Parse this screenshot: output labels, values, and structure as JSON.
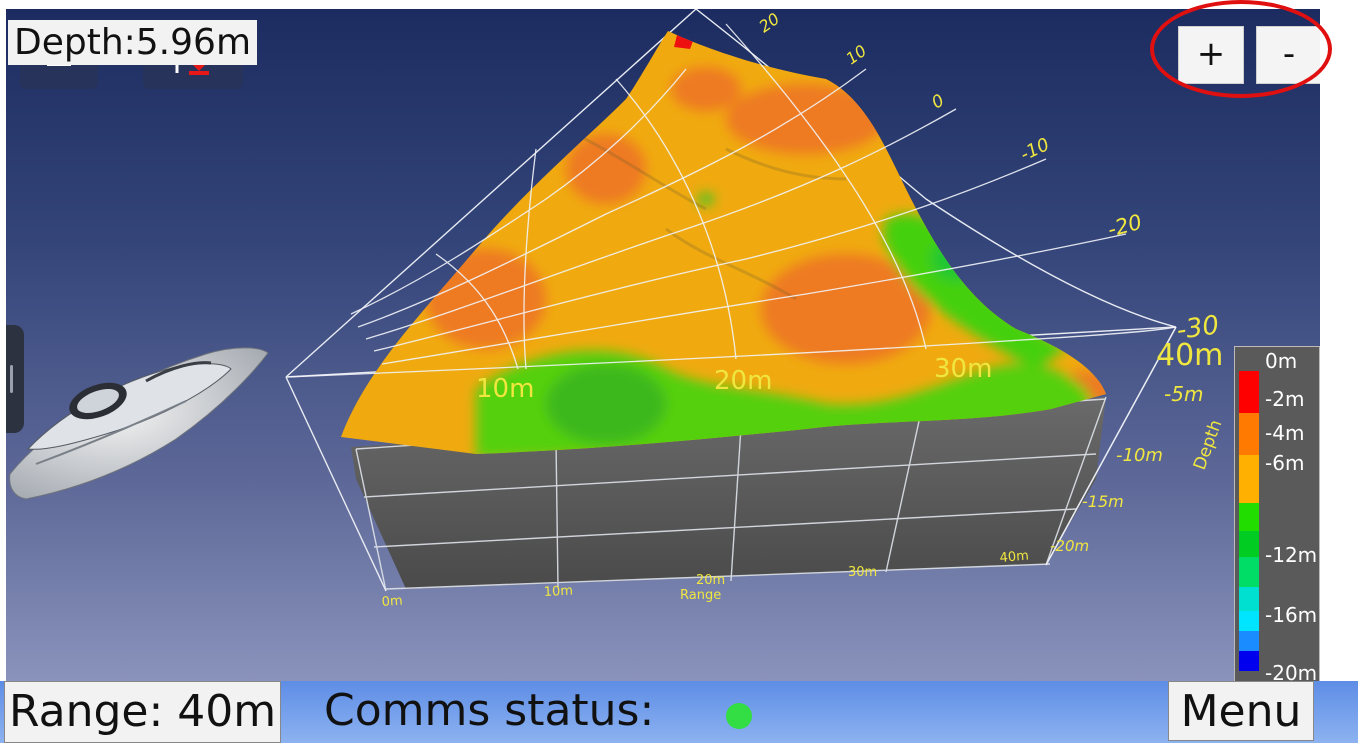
{
  "status": {
    "depth_readout": "Depth:5.96m"
  },
  "toolbar": {
    "zoom_in_label": "+",
    "zoom_out_label": "-"
  },
  "chart_data": {
    "type": "heatmap",
    "description_units": "3D sonar surface, depth colored",
    "range_axis": {
      "label": "Range",
      "ticks": [
        "0m",
        "10m",
        "20m",
        "30m",
        "40m"
      ]
    },
    "depth_axis": {
      "label": "Depth",
      "ticks": [
        "-5m",
        "-10m",
        "-15m",
        "-20m"
      ]
    },
    "surface_range_labels": [
      "10m",
      "20m",
      "30m",
      "40m"
    ],
    "lateral_ticks": [
      "-30",
      "-20",
      "-10",
      "0",
      "10",
      "20"
    ],
    "color_scale": {
      "labels": [
        "0m",
        "-2m",
        "-4m",
        "-6m",
        "-12m",
        "-16m",
        "-20m"
      ],
      "stops": [
        {
          "depth": -2,
          "color": "#ff0000"
        },
        {
          "depth": -4,
          "color": "#ff7a00"
        },
        {
          "depth": -6,
          "color": "#ffb000"
        },
        {
          "depth": -9,
          "color": "#22dd00"
        },
        {
          "depth": -12,
          "color": "#00dd66"
        },
        {
          "depth": -16,
          "color": "#00e5ff"
        },
        {
          "depth": -18,
          "color": "#1a8cff"
        },
        {
          "depth": -20,
          "color": "#0000ee"
        }
      ]
    }
  },
  "bottom_bar": {
    "range_label": "Range: 40m",
    "comms_label": "Comms status:",
    "comms_color": "#33dd44",
    "menu_label": "Menu"
  }
}
